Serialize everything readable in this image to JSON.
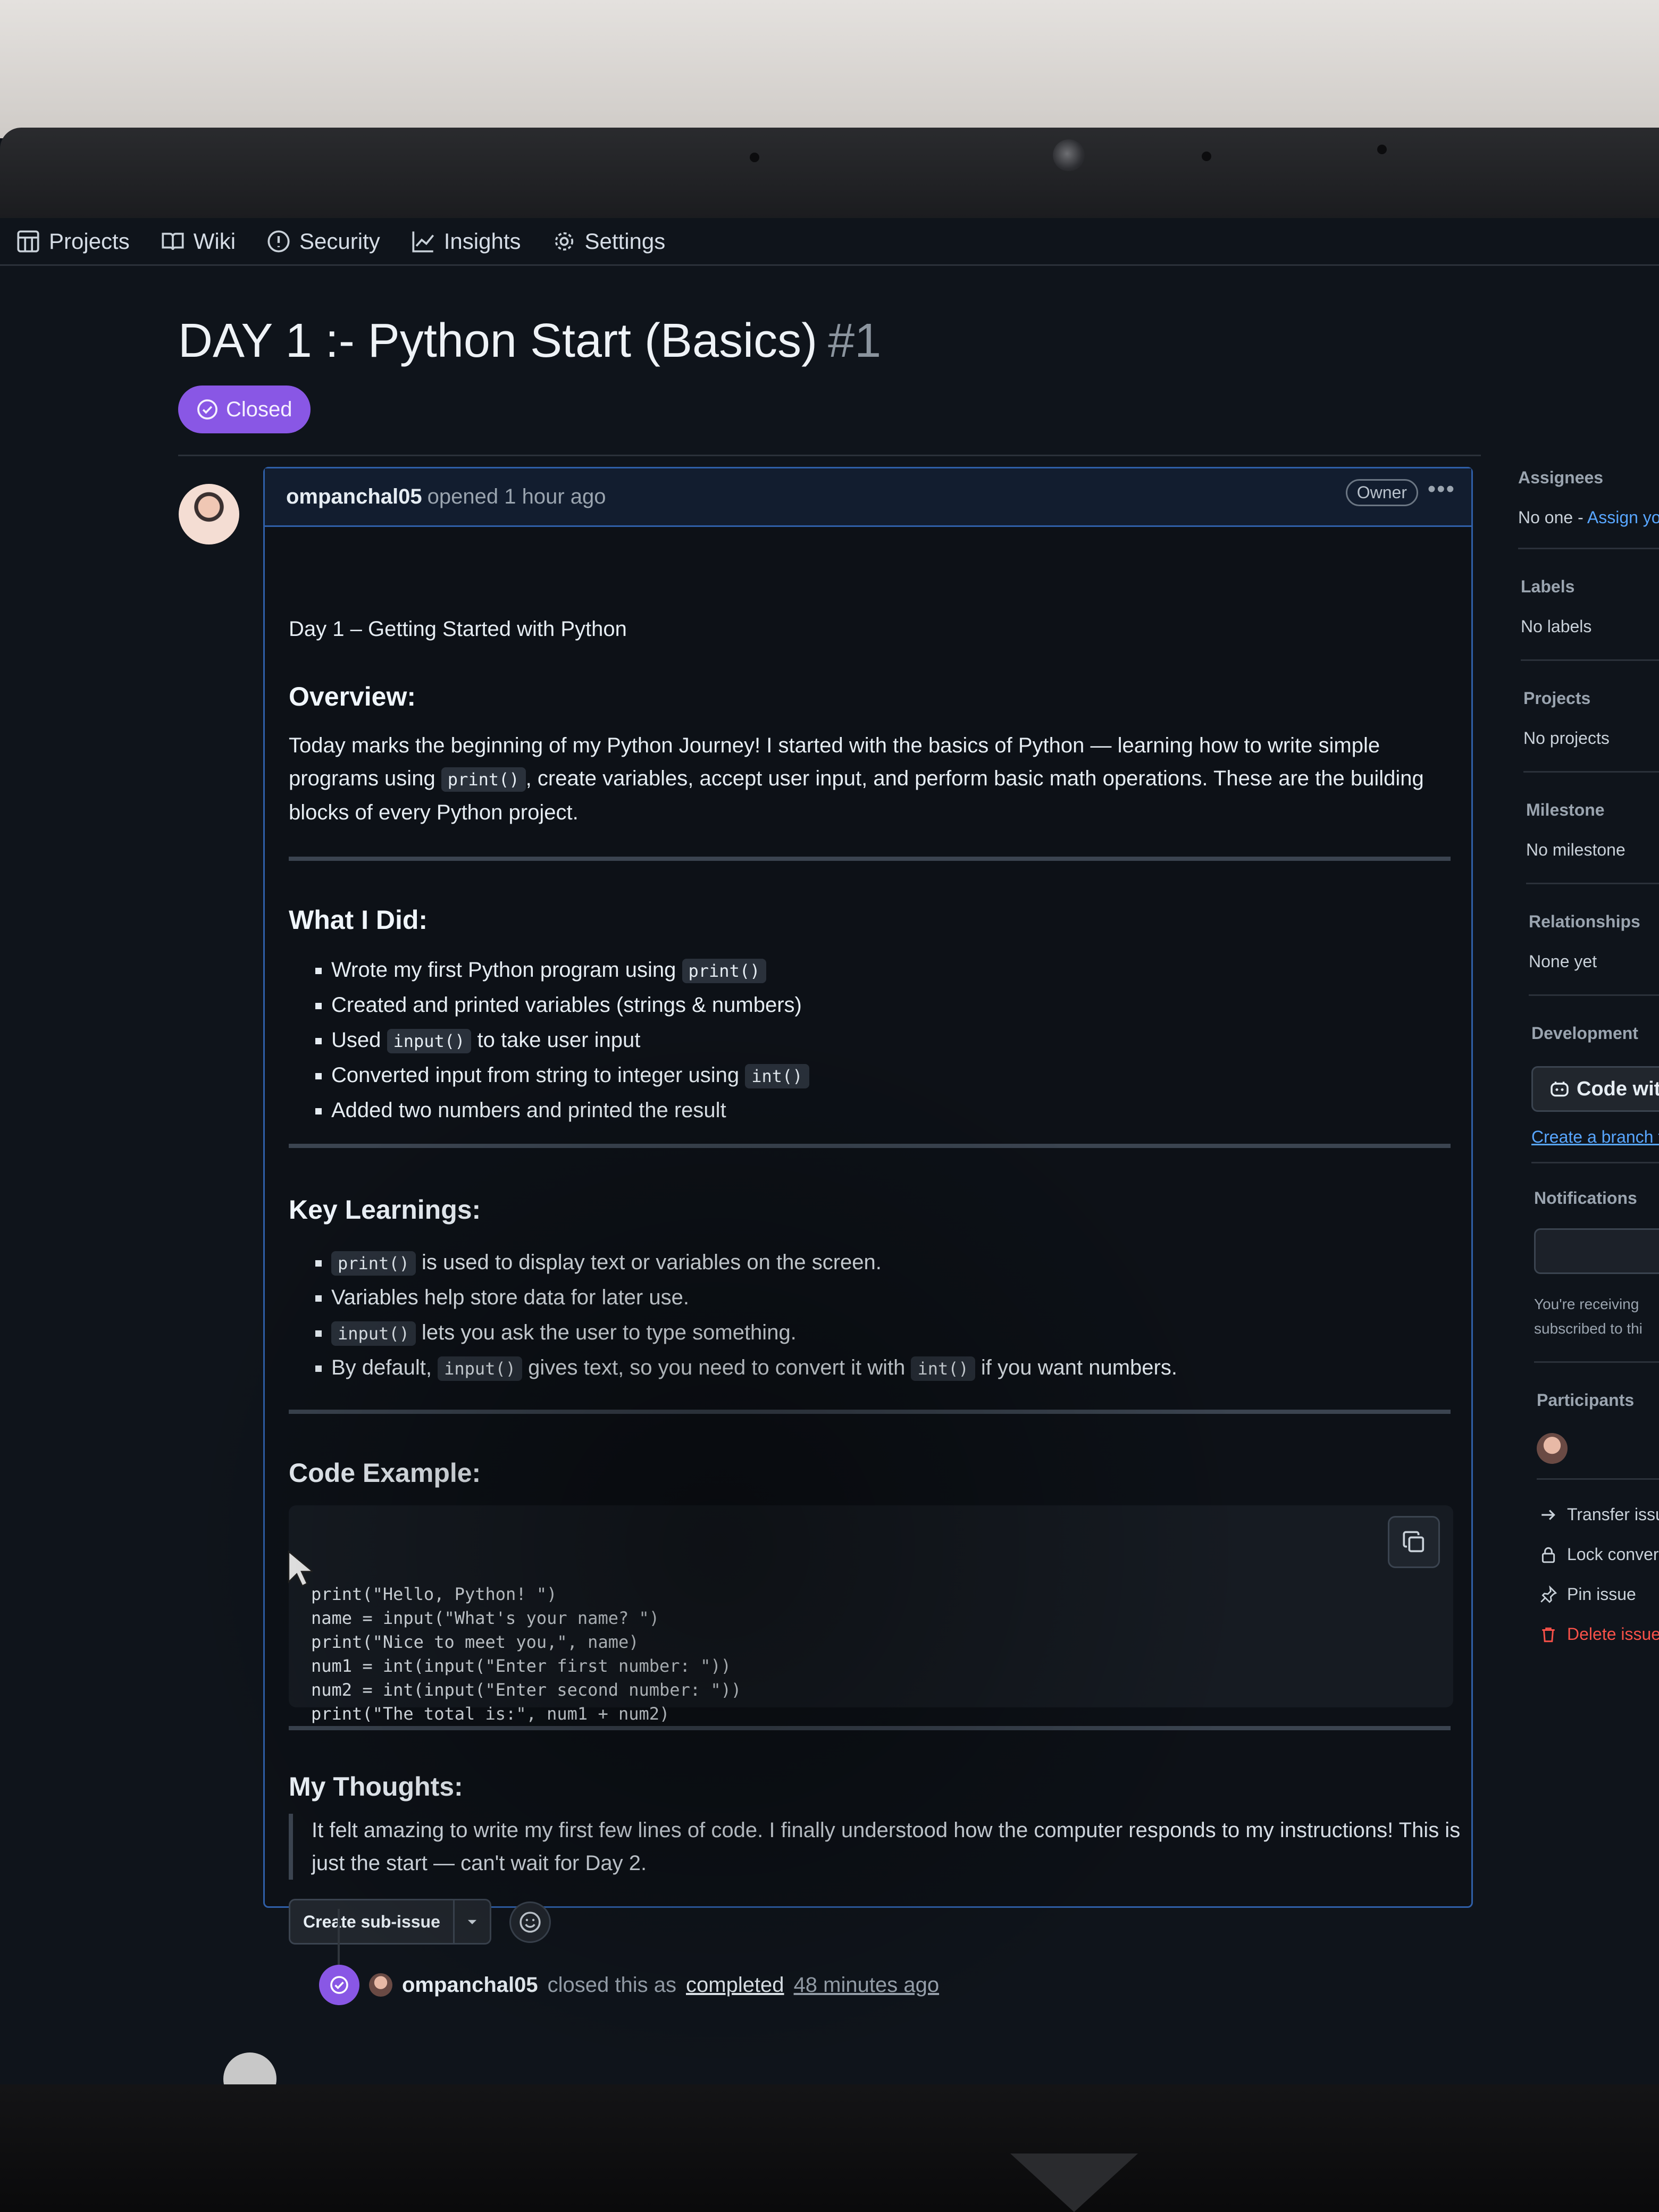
{
  "repo_nav": {
    "items": [
      {
        "label": "Projects",
        "icon": "table-icon"
      },
      {
        "label": "Wiki",
        "icon": "book-icon"
      },
      {
        "label": "Security",
        "icon": "shield-icon"
      },
      {
        "label": "Insights",
        "icon": "graph-icon"
      },
      {
        "label": "Settings",
        "icon": "gear-icon"
      }
    ]
  },
  "issue": {
    "title": "DAY 1 :- Python Start (Basics)",
    "number": "#1",
    "state": "Closed",
    "state_color": "#8957e5"
  },
  "comment": {
    "author": "ompanchal05",
    "meta": "opened 1 hour ago",
    "role_badge": "Owner",
    "intro": "Day 1 – Getting Started with Python",
    "overview": {
      "heading": "Overview:",
      "text_before_code": "Today marks the beginning of my Python Journey! I started with the basics of Python — learning how to write simple programs using ",
      "code": "print()",
      "text_after_code": ", create variables, accept user input, and perform basic math operations. These are the building blocks of every Python project."
    },
    "what_i_did": {
      "heading": "What I Did:",
      "items": [
        {
          "before": "Wrote my first Python program using ",
          "code": "print()",
          "after": ""
        },
        {
          "before": "Created and printed variables (strings & numbers)",
          "code": "",
          "after": ""
        },
        {
          "before": "Used ",
          "code": "input()",
          "after": " to take user input"
        },
        {
          "before": "Converted input from string to integer using ",
          "code": "int()",
          "after": ""
        },
        {
          "before": "Added two numbers and printed the result",
          "code": "",
          "after": ""
        }
      ]
    },
    "key_learnings": {
      "heading": "Key Learnings:",
      "items": [
        {
          "code": "print()",
          "text": " is used to display text or variables on the screen."
        },
        {
          "code": "",
          "text": "Variables help store data for later use."
        },
        {
          "code": "input()",
          "text": " lets you ask the user to type something."
        }
      ],
      "last_item": {
        "before": "By default, ",
        "code1": "input()",
        "middle": " gives text, so you need to convert it with ",
        "code2": "int()",
        "after": " if you want numbers."
      }
    },
    "code_example": {
      "heading": "Code Example:",
      "code": "print(\"Hello, Python! \")\nname = input(\"What's your name? \")\nprint(\"Nice to meet you,\", name)\nnum1 = int(input(\"Enter first number: \"))\nnum2 = int(input(\"Enter second number: \"))\nprint(\"The total is:\", num1 + num2)"
    },
    "thoughts": {
      "heading": "My Thoughts:",
      "quote": "It felt amazing to write my first few lines of code. I finally understood how the computer responds to my instructions! This is just the start — can't wait for Day 2."
    },
    "sub_issue_button": "Create sub-issue"
  },
  "timeline": {
    "author": "ompanchal05",
    "text": "closed this as",
    "link": "completed",
    "time": "48 minutes ago"
  },
  "sidebar": {
    "assignees": {
      "heading": "Assignees",
      "value": "No one - ",
      "link": "Assign yo"
    },
    "labels": {
      "heading": "Labels",
      "value": "No labels"
    },
    "projects": {
      "heading": "Projects",
      "value": "No projects"
    },
    "milestone": {
      "heading": "Milestone",
      "value": "No milestone"
    },
    "relationships": {
      "heading": "Relationships",
      "value": "None yet"
    },
    "development": {
      "heading": "Development",
      "button": "Code wit",
      "link": "Create a branch f"
    },
    "notifications": {
      "heading": "Notifications",
      "note_line1": "You're receiving",
      "note_line2": "subscribed to thi"
    },
    "participants": {
      "heading": "Participants"
    },
    "actions": [
      {
        "label": "Transfer issu",
        "icon": "arrow-right-icon"
      },
      {
        "label": "Lock conver",
        "icon": "lock-icon"
      },
      {
        "label": "Pin issue",
        "icon": "pin-icon"
      },
      {
        "label": "Delete issue",
        "icon": "trash-icon"
      }
    ]
  }
}
